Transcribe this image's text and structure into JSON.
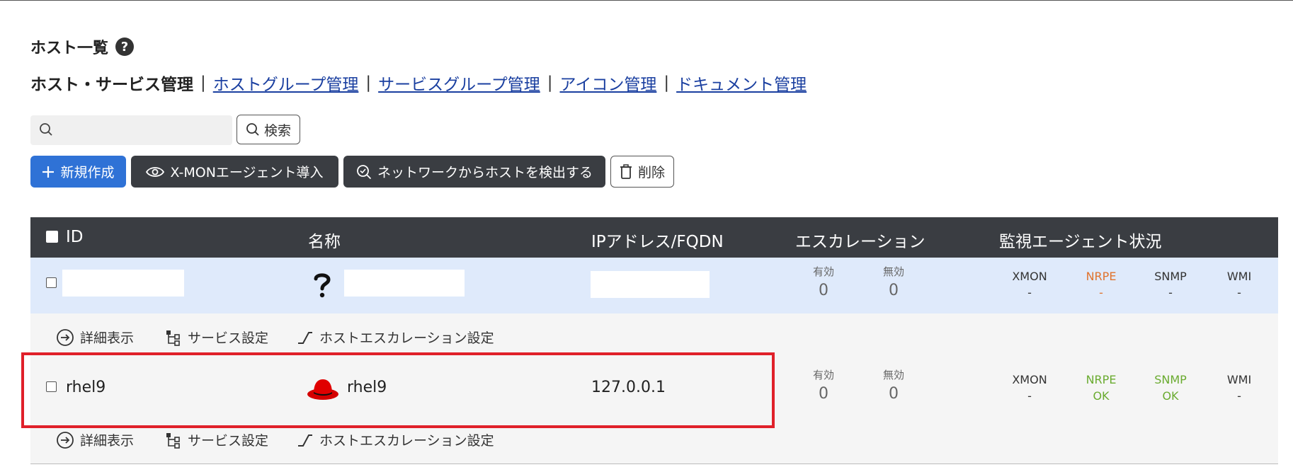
{
  "page": {
    "title": "ホスト一覧",
    "help": "?"
  },
  "nav": {
    "current": "ホスト・サービス管理",
    "separator": "|",
    "links": [
      "ホストグループ管理",
      "サービスグループ管理",
      "アイコン管理",
      "ドキュメント管理"
    ]
  },
  "search": {
    "placeholder": "",
    "button_label": "検索"
  },
  "toolbar": {
    "new_label": "新規作成",
    "agent_label": "X-MONエージェント導入",
    "detect_label": "ネットワークからホストを検出する",
    "delete_label": "削除"
  },
  "table": {
    "headers": [
      "ID",
      "名称",
      "IPアドレス/FQDN",
      "エスカレーション",
      "監視エージェント状況"
    ],
    "esc_labels": [
      "有効",
      "無効"
    ],
    "agent_names": [
      "XMON",
      "NRPE",
      "SNMP",
      "WMI"
    ],
    "rows": [
      {
        "id": "",
        "name": "",
        "ip": "",
        "icon": "question-icon",
        "esc_enabled": "0",
        "esc_disabled": "0",
        "agent_status": [
          "-",
          "-",
          "-",
          "-"
        ]
      },
      {
        "id": "rhel9",
        "name": "rhel9",
        "ip": "127.0.0.1",
        "icon": "redhat-icon",
        "esc_enabled": "0",
        "esc_disabled": "0",
        "agent_status": [
          "-",
          "OK",
          "OK",
          "-"
        ]
      }
    ],
    "actions": [
      "詳細表示",
      "サービス設定",
      "ホストエスカレーション設定"
    ]
  },
  "colors": {
    "primary": "#2f72d6",
    "dark": "#3a3d42",
    "selected_row": "#dfeafb",
    "ok_green": "#6aab30",
    "warn_orange": "#e0732d",
    "highlight_red": "#e0202a"
  }
}
